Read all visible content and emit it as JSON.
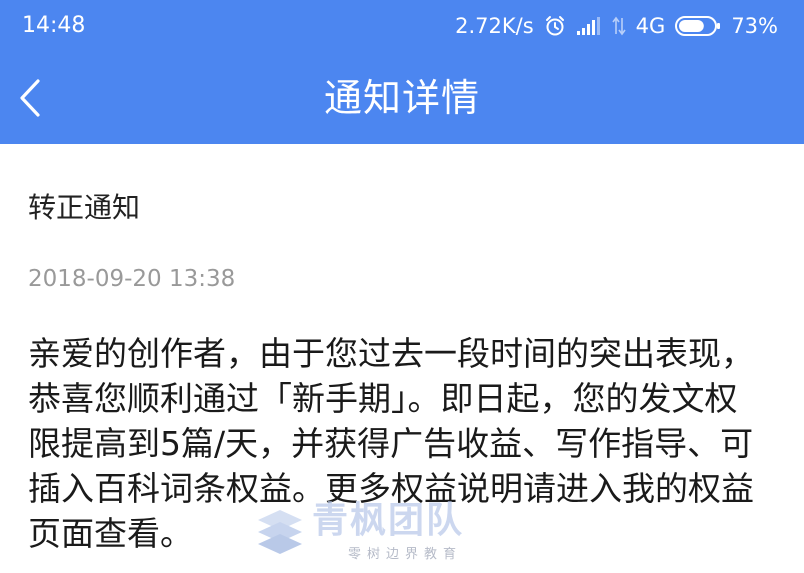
{
  "status_bar": {
    "time": "14:48",
    "net_speed": "2.72K/s",
    "network_type": "4G",
    "battery": "73%",
    "battery_level": 0.73,
    "icons": [
      "alarm-icon",
      "signal-icon",
      "data-arrows-icon",
      "battery-icon"
    ]
  },
  "title_bar": {
    "back_icon": "chevron-left-icon",
    "title": "通知详情"
  },
  "notice": {
    "title": "转正通知",
    "date": "2018-09-20 13:38",
    "body": "亲爱的创作者，由于您过去一段时间的突出表现，恭喜您顺利通过「新手期」。即日起，您的发文权限提高到5篇/天，并获得广告收益、写作指导、可插入百科词条权益。更多权益说明请进入我的权益页面查看。"
  },
  "watermark": {
    "text": "青枫团队",
    "subtext": "零树边界教育"
  },
  "colors": {
    "header_bg": "#4c86f0",
    "header_text": "#ffffff",
    "title_text": "#222222",
    "date_text": "#999999",
    "body_text": "#1a1a1a",
    "page_bg": "#ffffff"
  }
}
